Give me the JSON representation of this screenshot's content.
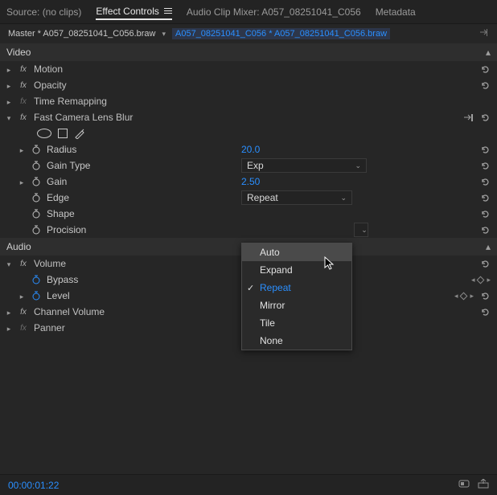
{
  "tabs": {
    "source": "Source: (no clips)",
    "effect_controls": "Effect Controls",
    "audio_mixer": "Audio Clip Mixer: A057_08251041_C056",
    "metadata": "Metadata"
  },
  "breadcrumb": {
    "master": "Master * A057_08251041_C056.braw",
    "clip": "A057_08251041_C056 * A057_08251041_C056.braw"
  },
  "sections": {
    "video": "Video",
    "audio": "Audio"
  },
  "video": {
    "motion": "Motion",
    "opacity": "Opacity",
    "time_remapping": "Time Remapping",
    "blur": {
      "name": "Fast Camera Lens Blur",
      "radius": {
        "label": "Radius",
        "value": "20.0"
      },
      "gain_type": {
        "label": "Gain Type",
        "value": "Exp"
      },
      "gain": {
        "label": "Gain",
        "value": "2.50"
      },
      "edge": {
        "label": "Edge",
        "value": "Repeat"
      },
      "shape": {
        "label": "Shape"
      },
      "procision": {
        "label": "Procision"
      }
    }
  },
  "audio_fx": {
    "volume": {
      "name": "Volume",
      "bypass": "Bypass",
      "level": "Level"
    },
    "channel_volume": "Channel Volume",
    "panner": "Panner"
  },
  "dropdown": {
    "auto": "Auto",
    "expand": "Expand",
    "repeat": "Repeat",
    "mirror": "Mirror",
    "tile": "Tile",
    "none": "None"
  },
  "footer": {
    "timecode": "00:00:01:22"
  }
}
